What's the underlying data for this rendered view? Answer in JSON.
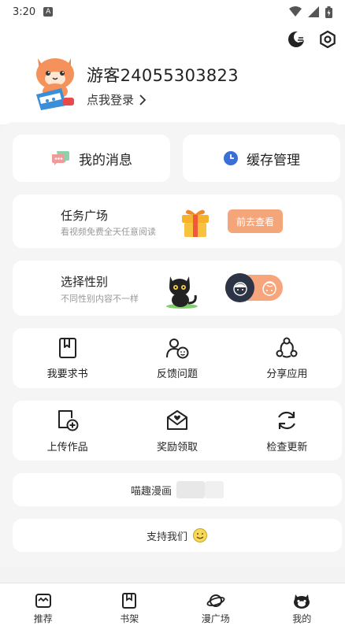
{
  "status_bar": {
    "time": "3:20",
    "notification_glyph": "A"
  },
  "header": {
    "username": "游客24055303823",
    "login_prompt": "点我登录",
    "chevron": "›"
  },
  "quick": {
    "messages_label": "我的消息",
    "cache_label": "缓存管理"
  },
  "task": {
    "title": "任务广场",
    "subtitle": "看视频免费全天任意阅读",
    "button_label": "前去查看"
  },
  "gender": {
    "title": "选择性别",
    "subtitle": "不同性别内容不一样"
  },
  "grid_row1": [
    {
      "label": "我要求书",
      "icon": "book-request-icon"
    },
    {
      "label": "反馈问题",
      "icon": "feedback-icon"
    },
    {
      "label": "分享应用",
      "icon": "share-icon"
    }
  ],
  "grid_row2": [
    {
      "label": "上传作品",
      "icon": "upload-icon"
    },
    {
      "label": "奖励领取",
      "icon": "reward-mail-icon"
    },
    {
      "label": "检查更新",
      "icon": "refresh-icon"
    }
  ],
  "app_name_label": "喵趣漫画",
  "support_label": "支持我们",
  "bottom_nav": [
    {
      "label": "推荐",
      "icon": "recommend-icon"
    },
    {
      "label": "书架",
      "icon": "bookshelf-icon"
    },
    {
      "label": "漫广场",
      "icon": "planet-icon"
    },
    {
      "label": "我的",
      "icon": "cat-face-icon"
    }
  ],
  "colors": {
    "accent_orange": "#f4a57a",
    "toggle_dark": "#2c3446",
    "clock_blue": "#3a6fd8"
  }
}
